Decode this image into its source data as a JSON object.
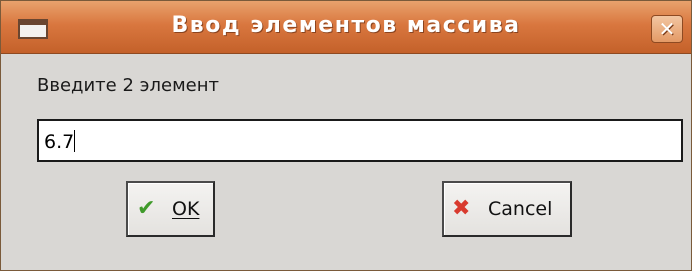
{
  "window": {
    "title": "Ввод элементов массива",
    "icon": "window-icon",
    "close_glyph": "✕"
  },
  "dialog": {
    "prompt": "Введите 2 элемент",
    "entry_value": "6.7"
  },
  "buttons": {
    "ok": {
      "icon": "checkmark-icon",
      "icon_glyph": "✔",
      "mnemonic": "O",
      "rest": "K"
    },
    "cancel": {
      "icon": "x-icon",
      "icon_glyph": "✖",
      "label": "Cancel"
    }
  },
  "colors": {
    "titlebar": "#d9773f",
    "ok_icon": "#3f9a2a",
    "cancel_icon": "#d83a2e"
  }
}
